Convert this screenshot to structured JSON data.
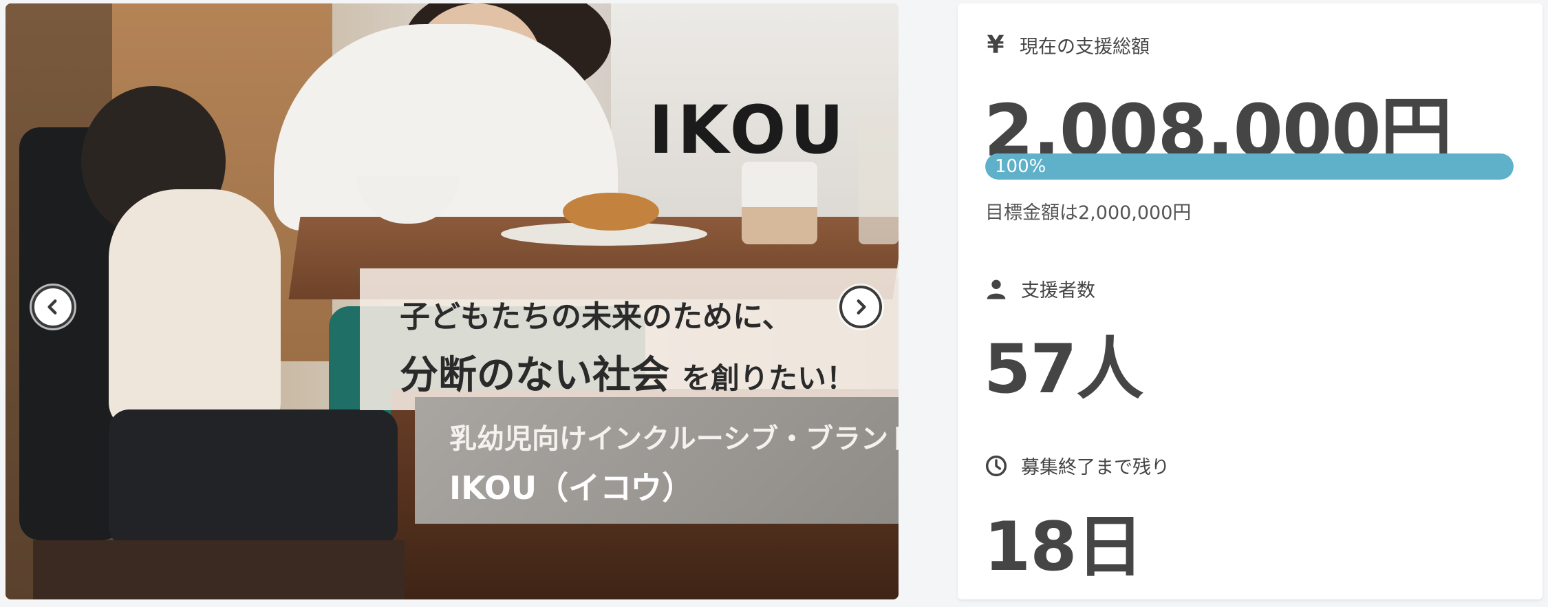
{
  "hero": {
    "brand_logo": "IKOU",
    "tagline_line1": "子どもたちの未来のために、",
    "tagline_line2_emphasis": "分断のない社会",
    "tagline_line2_rest": "を創りたい！",
    "brand_subtitle": "乳幼児向けインクルーシブ・ブランド",
    "brand_name": "IKOU（イコウ）",
    "prev_icon": "chevron-left-icon",
    "next_icon": "chevron-right-icon"
  },
  "stats": {
    "amount": {
      "icon": "yen-icon",
      "icon_glyph": "¥",
      "label": "現在の支援総額",
      "value": "2,008,000円"
    },
    "progress": {
      "percent": 100,
      "label": "100%",
      "color": "#5fb0c9"
    },
    "goal_text": "目標金額は2,000,000円",
    "backers": {
      "icon": "user-icon",
      "label": "支援者数",
      "value": "57人"
    },
    "remaining": {
      "icon": "clock-icon",
      "label": "募集終了まで残り",
      "value": "18日"
    }
  }
}
